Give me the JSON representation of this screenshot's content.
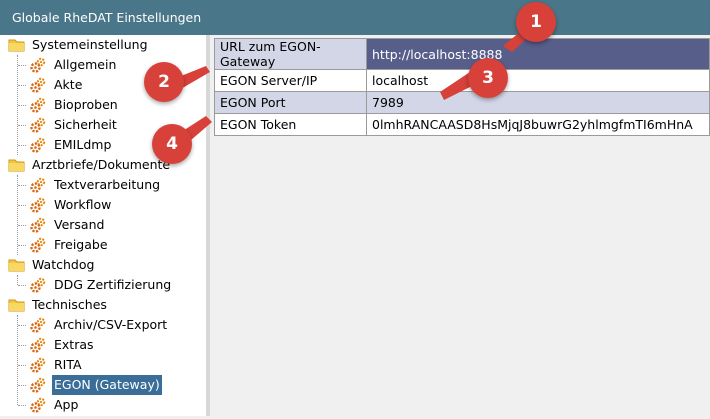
{
  "window": {
    "title": "Globale RheDAT Einstellungen"
  },
  "tree": [
    {
      "label": "Systemeinstellung",
      "type": "folder",
      "level": 0
    },
    {
      "label": "Allgemein",
      "type": "gear",
      "level": 1
    },
    {
      "label": "Akte",
      "type": "gear",
      "level": 1
    },
    {
      "label": "Bioproben",
      "type": "gear",
      "level": 1
    },
    {
      "label": "Sicherheit",
      "type": "gear",
      "level": 1
    },
    {
      "label": "EMILdmp",
      "type": "gear",
      "level": 1
    },
    {
      "label": "Arztbriefe/Dokumente",
      "type": "folder",
      "level": 0
    },
    {
      "label": "Textverarbeitung",
      "type": "gear",
      "level": 1
    },
    {
      "label": "Workflow",
      "type": "gear",
      "level": 1
    },
    {
      "label": "Versand",
      "type": "gear",
      "level": 1
    },
    {
      "label": "Freigabe",
      "type": "gear",
      "level": 1
    },
    {
      "label": "Watchdog",
      "type": "folder",
      "level": 0
    },
    {
      "label": "DDG Zertifizierung",
      "type": "gear",
      "level": 1
    },
    {
      "label": "Technisches",
      "type": "folder",
      "level": 0
    },
    {
      "label": "Archiv/CSV-Export",
      "type": "gear",
      "level": 1
    },
    {
      "label": "Extras",
      "type": "gear",
      "level": 1
    },
    {
      "label": "RITA",
      "type": "gear",
      "level": 1
    },
    {
      "label": "EGON (Gateway)",
      "type": "gear",
      "level": 1,
      "selected": true
    },
    {
      "label": "App",
      "type": "gear",
      "level": 1
    }
  ],
  "properties": [
    {
      "key": "URL zum EGON-Gateway",
      "value": "http://localhost:8888"
    },
    {
      "key": "EGON Server/IP",
      "value": "localhost"
    },
    {
      "key": "EGON Port",
      "value": "7989"
    },
    {
      "key": "EGON Token",
      "value": "0lmhRANCAASD8HsMjqJ8buwrG2yhlmgfmTI6mHnA"
    }
  ],
  "annotations": [
    "1",
    "2",
    "3",
    "4"
  ],
  "colors": {
    "titlebar": "#4a7689",
    "selected": "#3a6d97",
    "marker": "#d7413a",
    "alt_row": "#d3d6e6"
  }
}
